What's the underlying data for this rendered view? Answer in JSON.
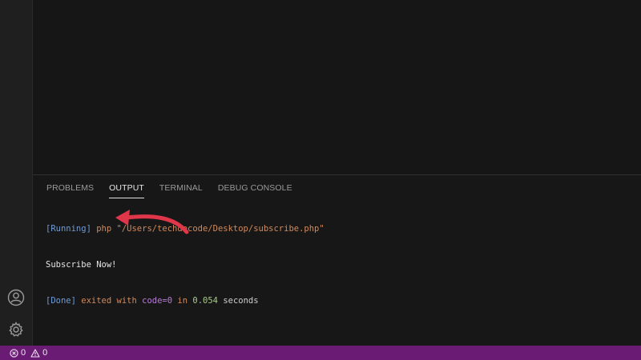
{
  "panel": {
    "tabs": [
      {
        "label": "PROBLEMS",
        "active": false
      },
      {
        "label": "OUTPUT",
        "active": true
      },
      {
        "label": "TERMINAL",
        "active": false
      },
      {
        "label": "DEBUG CONSOLE",
        "active": false
      }
    ],
    "output": {
      "running_tag": "[Running]",
      "command": "php \"/Users/techdecode/Desktop/subscribe.php\"",
      "program_output": "Subscribe Now!",
      "done_tag": "[Done]",
      "exited_with": "exited with",
      "code_label": "code=0",
      "in_label": "in",
      "duration": "0.054",
      "seconds_label": "seconds"
    }
  },
  "activity_bar": {
    "icons": [
      "account-icon",
      "gear-icon"
    ]
  },
  "status_bar": {
    "errors_count": "0",
    "warnings_count": "0",
    "background": "#6a1b74"
  },
  "colors": {
    "arrow": "#e0364a"
  }
}
